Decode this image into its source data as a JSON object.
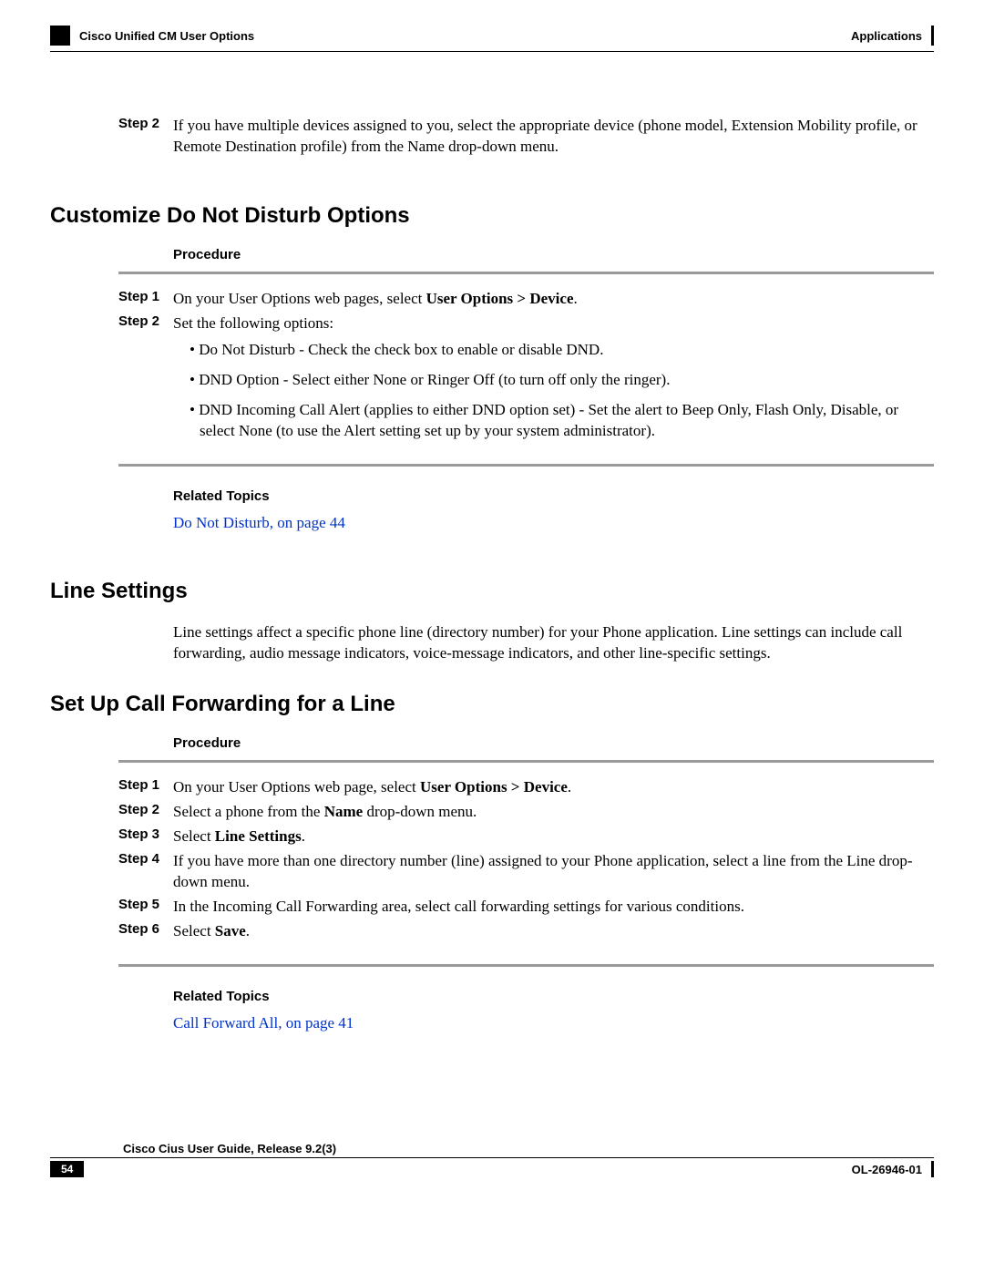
{
  "header": {
    "left": "Cisco Unified CM User Options",
    "right": "Applications"
  },
  "intro_step": {
    "label": "Step 2",
    "text": "If you have multiple devices assigned to you, select the appropriate device (phone model, Extension Mobility profile, or Remote Destination profile) from the Name drop-down menu."
  },
  "section1": {
    "heading": "Customize Do Not Disturb Options",
    "procedure_label": "Procedure",
    "step1": {
      "label": "Step 1",
      "prefix": "On your User Options web pages, select ",
      "bold": "User Options > Device",
      "suffix": "."
    },
    "step2": {
      "label": "Step 2",
      "text": "Set the following options:"
    },
    "bullets": [
      "• Do Not Disturb - Check the check box to enable or disable DND.",
      "• DND Option - Select either None or Ringer Off (to turn off only the ringer).",
      "• DND Incoming Call Alert (applies to either DND option set) - Set the alert to Beep Only, Flash Only, Disable, or select None (to use the Alert setting set up by your system administrator)."
    ],
    "related_label": "Related Topics",
    "related_link": "Do Not Disturb,  on page 44"
  },
  "section2": {
    "heading": "Line Settings",
    "text": "Line settings affect a specific phone line (directory number) for your Phone application. Line settings can include call forwarding, audio message indicators, voice-message indicators, and other line-specific settings."
  },
  "section3": {
    "heading": "Set Up Call Forwarding for a Line",
    "procedure_label": "Procedure",
    "steps": {
      "s1": {
        "label": "Step 1",
        "prefix": "On your User Options web page, select ",
        "bold": "User Options > Device",
        "suffix": "."
      },
      "s2": {
        "label": "Step 2",
        "prefix": "Select a phone from the ",
        "bold": "Name",
        "suffix": " drop-down menu."
      },
      "s3": {
        "label": "Step 3",
        "prefix": "Select ",
        "bold": "Line Settings",
        "suffix": "."
      },
      "s4": {
        "label": "Step 4",
        "text": "If you have more than one directory number (line) assigned to your Phone application, select a line from the Line drop-down menu."
      },
      "s5": {
        "label": "Step 5",
        "text": "In the Incoming Call Forwarding area, select call forwarding settings for various conditions."
      },
      "s6": {
        "label": "Step 6",
        "prefix": "Select ",
        "bold": "Save",
        "suffix": "."
      }
    },
    "related_label": "Related Topics",
    "related_link": "Call Forward All,  on page 41"
  },
  "footer": {
    "title": "Cisco Cius User Guide, Release 9.2(3)",
    "page": "54",
    "docid": "OL-26946-01"
  }
}
